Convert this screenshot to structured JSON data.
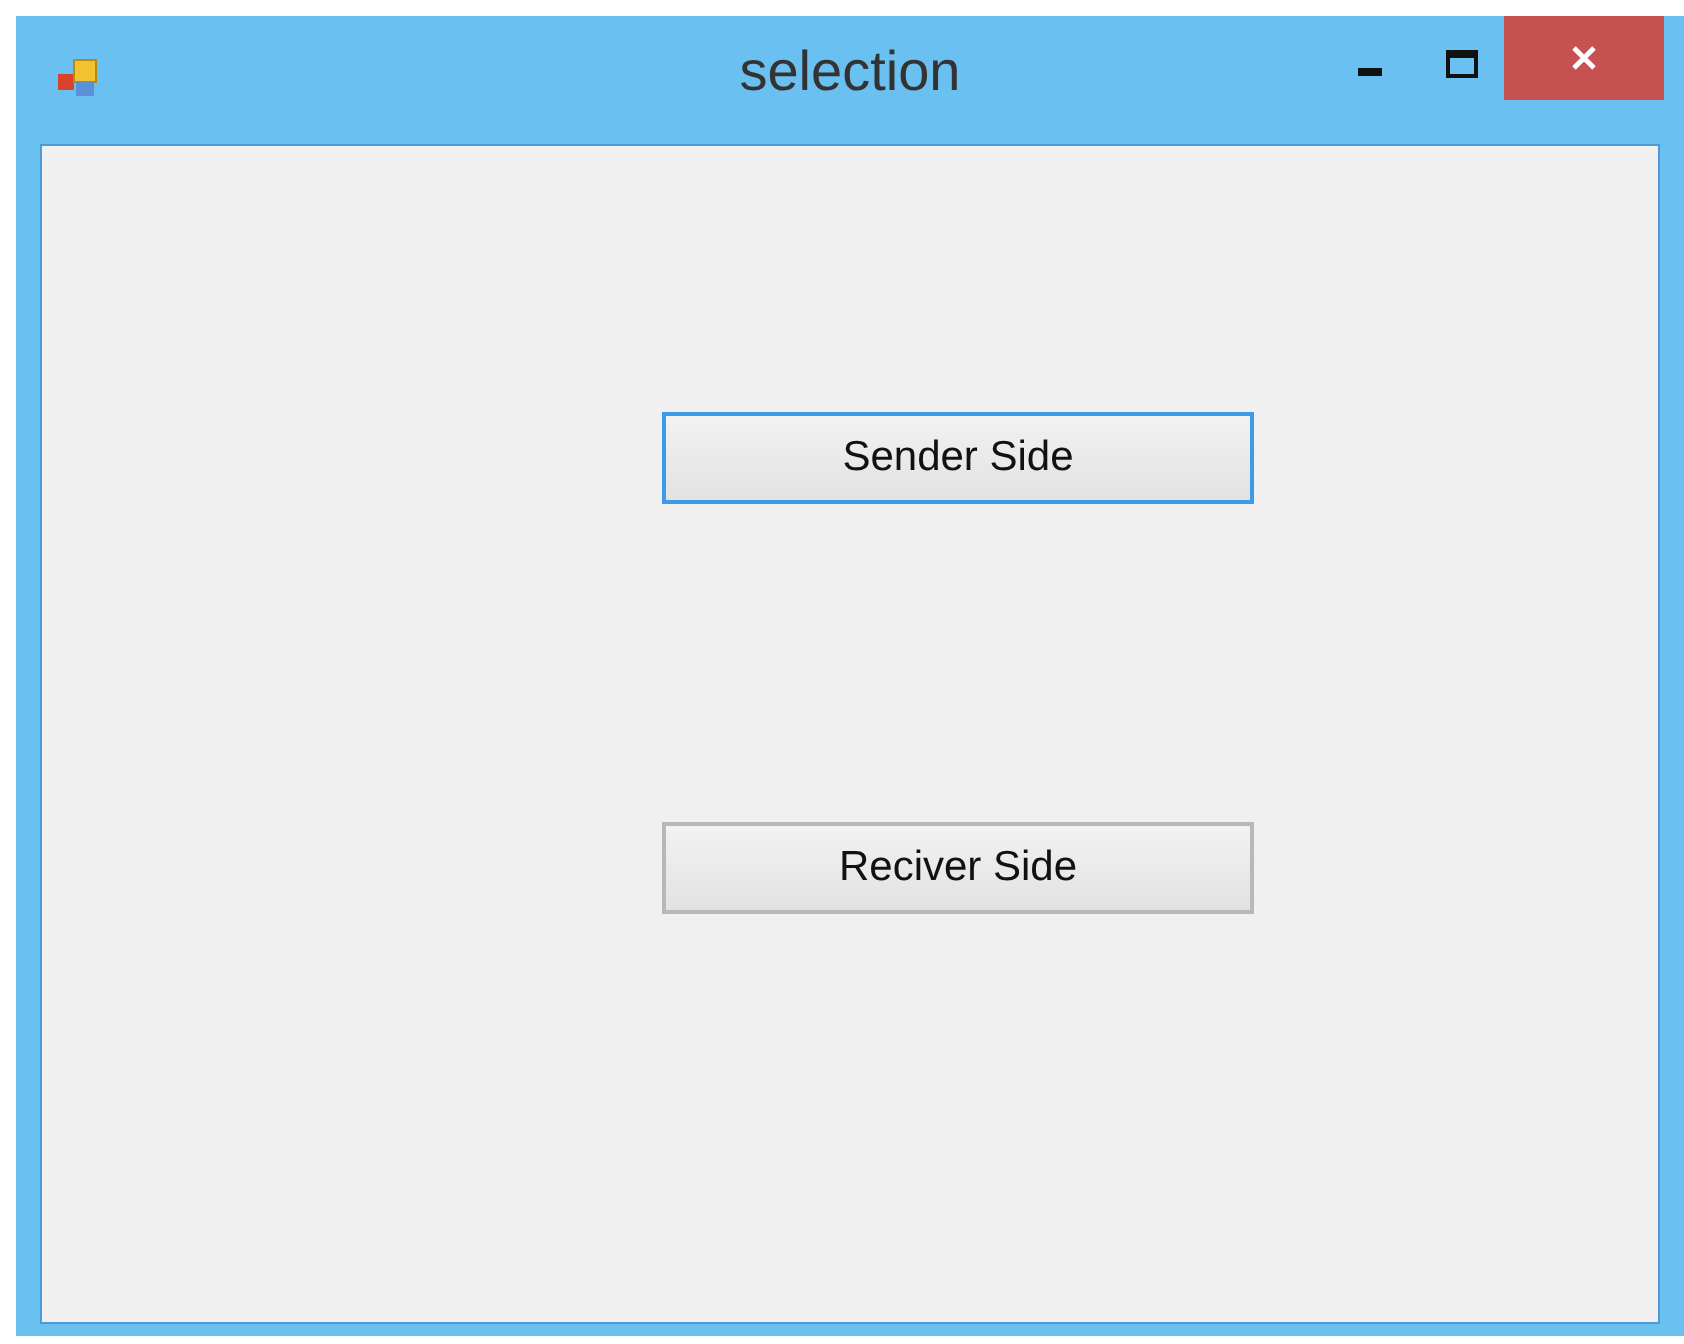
{
  "window": {
    "title": "selection"
  },
  "buttons": [
    {
      "label": "Sender Side",
      "focused": true
    },
    {
      "label": "Reciver Side",
      "focused": false
    }
  ]
}
